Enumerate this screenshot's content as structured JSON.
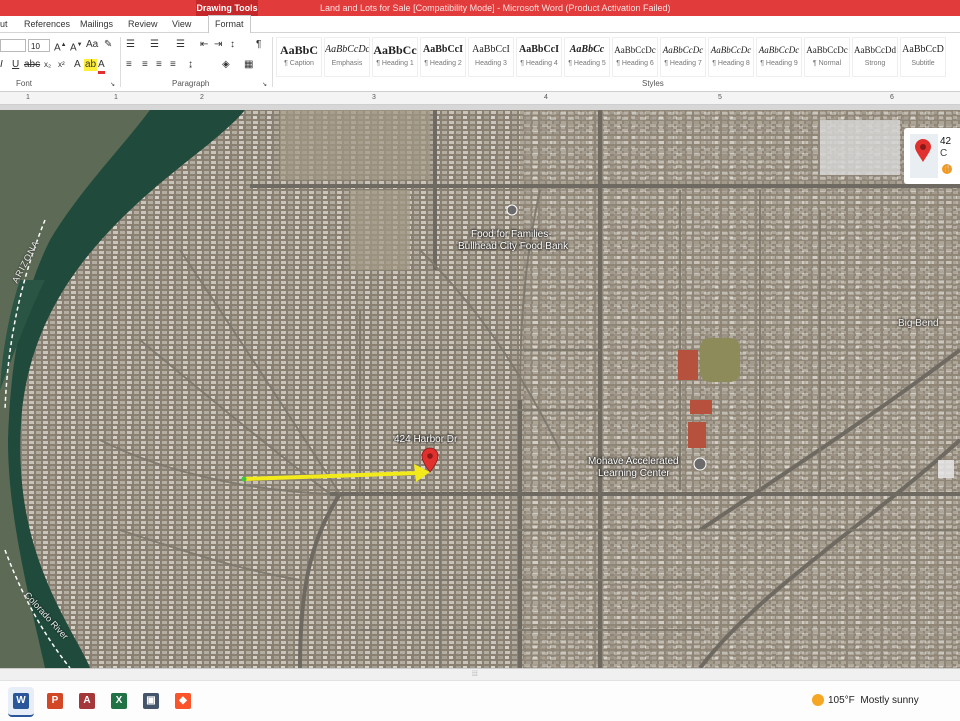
{
  "window": {
    "title": "Land and Lots for Sale [Compatibility Mode] - Microsoft Word (Product Activation Failed)",
    "contextual_tab_group": "Drawing Tools"
  },
  "tabs": [
    {
      "label": "ut"
    },
    {
      "label": "References"
    },
    {
      "label": "Mailings"
    },
    {
      "label": "Review"
    },
    {
      "label": "View"
    },
    {
      "label": "Format"
    }
  ],
  "ribbon": {
    "font": {
      "size_value": "10",
      "group_label": "Font"
    },
    "paragraph": {
      "group_label": "Paragraph"
    },
    "styles": {
      "group_label": "Styles",
      "items": [
        {
          "preview": "AaBbC",
          "name": "¶ Caption"
        },
        {
          "preview": "AaBbCcDc",
          "name": "Emphasis"
        },
        {
          "preview": "AaBbCc",
          "name": "¶ Heading 1"
        },
        {
          "preview": "AaBbCcI",
          "name": "¶ Heading 2"
        },
        {
          "preview": "AaBbCcI",
          "name": "Heading 3"
        },
        {
          "preview": "AaBbCcI",
          "name": "¶ Heading 4"
        },
        {
          "preview": "AaBbCc",
          "name": "¶ Heading 5"
        },
        {
          "preview": "AaBbCcDc",
          "name": "¶ Heading 6"
        },
        {
          "preview": "AaBbCcDc",
          "name": "¶ Heading 7"
        },
        {
          "preview": "AaBbCcDc",
          "name": "¶ Heading 8"
        },
        {
          "preview": "AaBbCcDc",
          "name": "¶ Heading 9"
        },
        {
          "preview": "AaBbCcDc",
          "name": "¶ Normal"
        },
        {
          "preview": "AaBbCcDd",
          "name": "Strong"
        },
        {
          "preview": "AaBbCcD",
          "name": "Subtitle"
        }
      ]
    }
  },
  "ruler": {
    "numbers": [
      "1",
      "1",
      "2",
      "3",
      "4",
      "5",
      "6"
    ]
  },
  "map": {
    "labels": {
      "food_bank_line1": "Food for Families-",
      "food_bank_line2": "Bullhead City Food Bank",
      "address": "424 Harbor Dr",
      "school_line1": "Mohave Accelerated",
      "school_line2": "Learning Center",
      "big_bend": "Big Bend",
      "arizona": "ARIZONA",
      "colorado_river": "Colorado River"
    },
    "card": {
      "line1": "42",
      "line2": "C"
    },
    "colors": {
      "arrow": "#f2ea1a",
      "pin": "#e0312f",
      "river": "#1f4a3c"
    }
  },
  "taskbar": {
    "apps": [
      {
        "name": "word",
        "glyph": "W",
        "color": "#2b579a"
      },
      {
        "name": "powerpoint",
        "glyph": "P",
        "color": "#d24726"
      },
      {
        "name": "access",
        "glyph": "A",
        "color": "#a4373a"
      },
      {
        "name": "excel",
        "glyph": "X",
        "color": "#217346"
      },
      {
        "name": "car-app",
        "glyph": "▣",
        "color": "#44546a"
      },
      {
        "name": "brave",
        "glyph": "◆",
        "color": "#fb542b"
      }
    ],
    "weather": {
      "temp": "105°F",
      "condition": "Mostly sunny"
    }
  }
}
